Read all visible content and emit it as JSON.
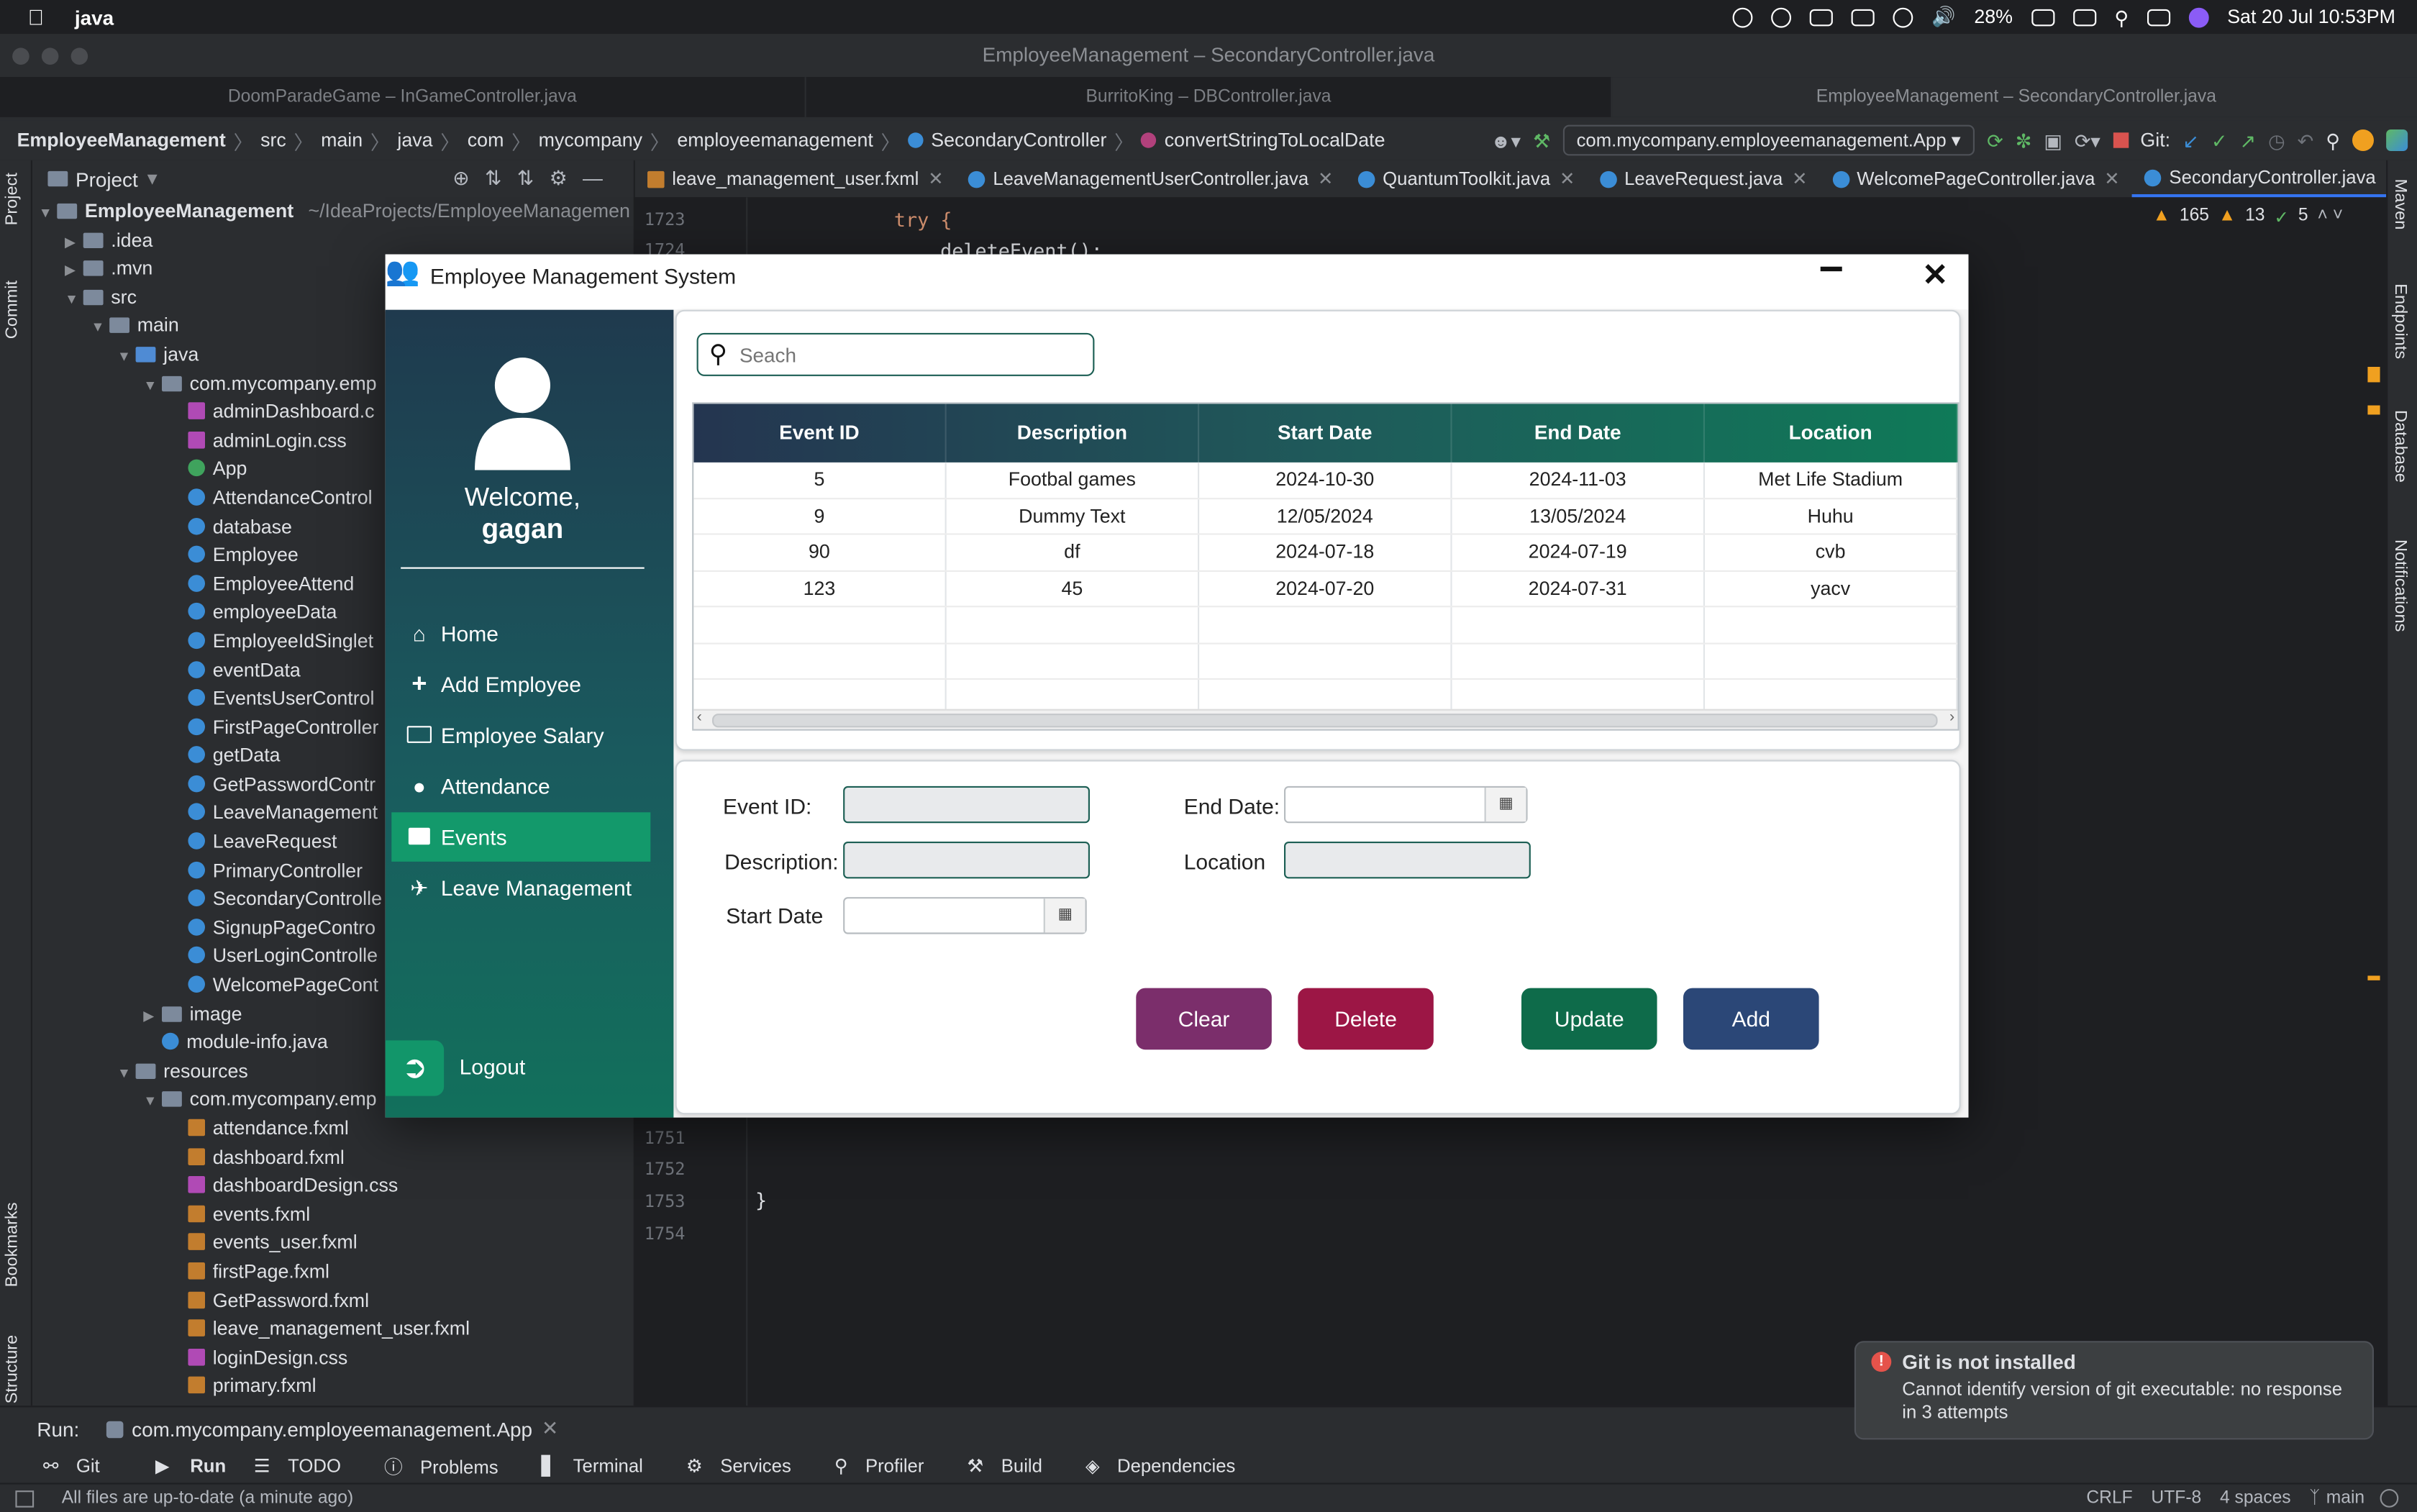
{
  "menubar": {
    "app_name": "java",
    "battery": "28%",
    "datetime": "Sat 20 Jul  10:53PM"
  },
  "window": {
    "title": "EmployeeManagement – SecondaryController.java",
    "project_tabs": [
      "DoomParadeGame – InGameController.java",
      "BurritoKing – DBController.java",
      "EmployeeManagement – SecondaryController.java"
    ]
  },
  "navbar": {
    "crumbs": [
      "EmployeeManagement",
      "src",
      "main",
      "java",
      "com",
      "mycompany",
      "employeemanagement"
    ],
    "class_crumb": "SecondaryController",
    "method_crumb": "convertStringToLocalDate",
    "run_config": "com.mycompany.employeemanagement.App",
    "git_label": "Git:"
  },
  "left_strip": {
    "project": "Project",
    "commit": "Commit",
    "bookmarks": "Bookmarks",
    "structure": "Structure"
  },
  "right_strip": {
    "maven": "Maven",
    "endpoints": "Endpoints",
    "database": "Database",
    "notifications": "Notifications"
  },
  "project_panel": {
    "title": "Project",
    "root": "EmployeeManagement",
    "root_path": "~/IdeaProjects/EmployeeManagemen",
    "tree": [
      {
        "label": ".idea",
        "depth": 1,
        "kind": "folder",
        "arrow": "▶"
      },
      {
        "label": ".mvn",
        "depth": 1,
        "kind": "folder",
        "arrow": "▶"
      },
      {
        "label": "src",
        "depth": 1,
        "kind": "folder",
        "arrow": "▼"
      },
      {
        "label": "main",
        "depth": 2,
        "kind": "folder",
        "arrow": "▼"
      },
      {
        "label": "java",
        "depth": 3,
        "kind": "folder-blue",
        "arrow": "▼"
      },
      {
        "label": "com.mycompany.emp",
        "depth": 4,
        "kind": "folder",
        "arrow": "▼"
      },
      {
        "label": "adminDashboard.c",
        "depth": 5,
        "kind": "css",
        "arrow": ""
      },
      {
        "label": "adminLogin.css",
        "depth": 5,
        "kind": "css",
        "arrow": ""
      },
      {
        "label": "App",
        "depth": 5,
        "kind": "app",
        "arrow": ""
      },
      {
        "label": "AttendanceControl",
        "depth": 5,
        "kind": "class",
        "arrow": ""
      },
      {
        "label": "database",
        "depth": 5,
        "kind": "class",
        "arrow": ""
      },
      {
        "label": "Employee",
        "depth": 5,
        "kind": "class",
        "arrow": ""
      },
      {
        "label": "EmployeeAttend",
        "depth": 5,
        "kind": "class",
        "arrow": ""
      },
      {
        "label": "employeeData",
        "depth": 5,
        "kind": "class",
        "arrow": ""
      },
      {
        "label": "EmployeeIdSinglet",
        "depth": 5,
        "kind": "class",
        "arrow": ""
      },
      {
        "label": "eventData",
        "depth": 5,
        "kind": "class",
        "arrow": ""
      },
      {
        "label": "EventsUserControl",
        "depth": 5,
        "kind": "class",
        "arrow": ""
      },
      {
        "label": "FirstPageController",
        "depth": 5,
        "kind": "class",
        "arrow": ""
      },
      {
        "label": "getData",
        "depth": 5,
        "kind": "class",
        "arrow": ""
      },
      {
        "label": "GetPasswordContr",
        "depth": 5,
        "kind": "class",
        "arrow": ""
      },
      {
        "label": "LeaveManagement",
        "depth": 5,
        "kind": "class",
        "arrow": ""
      },
      {
        "label": "LeaveRequest",
        "depth": 5,
        "kind": "class",
        "arrow": ""
      },
      {
        "label": "PrimaryController",
        "depth": 5,
        "kind": "class",
        "arrow": ""
      },
      {
        "label": "SecondaryControlle",
        "depth": 5,
        "kind": "class",
        "arrow": ""
      },
      {
        "label": "SignupPageContro",
        "depth": 5,
        "kind": "class",
        "arrow": ""
      },
      {
        "label": "UserLoginControlle",
        "depth": 5,
        "kind": "class",
        "arrow": ""
      },
      {
        "label": "WelcomePageCont",
        "depth": 5,
        "kind": "class",
        "arrow": ""
      },
      {
        "label": "image",
        "depth": 4,
        "kind": "folder",
        "arrow": "▶"
      },
      {
        "label": "module-info.java",
        "depth": 4,
        "kind": "class",
        "arrow": ""
      },
      {
        "label": "resources",
        "depth": 3,
        "kind": "folder",
        "arrow": "▼"
      },
      {
        "label": "com.mycompany.emp",
        "depth": 4,
        "kind": "folder",
        "arrow": "▼"
      },
      {
        "label": "attendance.fxml",
        "depth": 5,
        "kind": "fx",
        "arrow": ""
      },
      {
        "label": "dashboard.fxml",
        "depth": 5,
        "kind": "fx",
        "arrow": ""
      },
      {
        "label": "dashboardDesign.css",
        "depth": 5,
        "kind": "css",
        "arrow": ""
      },
      {
        "label": "events.fxml",
        "depth": 5,
        "kind": "fx",
        "arrow": ""
      },
      {
        "label": "events_user.fxml",
        "depth": 5,
        "kind": "fx",
        "arrow": ""
      },
      {
        "label": "firstPage.fxml",
        "depth": 5,
        "kind": "fx",
        "arrow": ""
      },
      {
        "label": "GetPassword.fxml",
        "depth": 5,
        "kind": "fx",
        "arrow": ""
      },
      {
        "label": "leave_management_user.fxml",
        "depth": 5,
        "kind": "fx",
        "arrow": ""
      },
      {
        "label": "loginDesign.css",
        "depth": 5,
        "kind": "css",
        "arrow": ""
      },
      {
        "label": "primary.fxml",
        "depth": 5,
        "kind": "fx",
        "arrow": ""
      }
    ]
  },
  "editor_tabs": [
    {
      "label": "leave_management_user.fxml",
      "active": false
    },
    {
      "label": "LeaveManagementUserController.java",
      "active": false
    },
    {
      "label": "QuantumToolkit.java",
      "active": false
    },
    {
      "label": "LeaveRequest.java",
      "active": false
    },
    {
      "label": "WelcomePageController.java",
      "active": false
    },
    {
      "label": "SecondaryController.java",
      "active": true
    }
  ],
  "inspections": {
    "warnings": "165",
    "weak": "13",
    "ok": "5"
  },
  "editor": {
    "lines_top": [
      {
        "num": "1723",
        "code": "try {"
      },
      {
        "num": "1724",
        "code": "deleteEvent();"
      }
    ],
    "lines_bottom": [
      {
        "num": "1751",
        "code": ""
      },
      {
        "num": "1752",
        "code": ""
      },
      {
        "num": "1753",
        "code": "}"
      },
      {
        "num": "1754",
        "code": ""
      }
    ]
  },
  "run_bar": {
    "label": "Run:",
    "config": "com.mycompany.employeemanagement.App"
  },
  "bottom_tabs": [
    "Git",
    "Run",
    "TODO",
    "Problems",
    "Terminal",
    "Services",
    "Profiler",
    "Build",
    "Dependencies"
  ],
  "status_bar": {
    "message": "All files are up-to-date (a minute ago)",
    "line_sep": "CRLF",
    "encoding": "UTF-8",
    "indent": "4 spaces",
    "branch": "main"
  },
  "notification": {
    "title": "Git is not installed",
    "body": "Cannot identify version of git executable: no response in 3 attempts"
  },
  "app": {
    "title": "Employee Management System",
    "welcome": "Welcome,",
    "username": "gagan",
    "nav": [
      {
        "label": "Home",
        "icon": "home-icon",
        "active": false
      },
      {
        "label": "Add Employee",
        "icon": "plus-icon",
        "active": false
      },
      {
        "label": "Employee Salary",
        "icon": "money-icon",
        "active": false
      },
      {
        "label": "Attendance",
        "icon": "user-icon",
        "active": false
      },
      {
        "label": "Events",
        "icon": "archive-icon",
        "active": true
      },
      {
        "label": "Leave Management",
        "icon": "plane-icon",
        "active": false
      }
    ],
    "logout": "Logout",
    "search_placeholder": "Seach",
    "table": {
      "columns": [
        "Event ID",
        "Description",
        "Start Date",
        "End Date",
        "Location"
      ],
      "rows": [
        [
          "5",
          "Footbal games",
          "2024-10-30",
          "2024-11-03",
          "Met Life Stadium"
        ],
        [
          "9",
          "Dummy Text",
          "12/05/2024",
          "13/05/2024",
          "Huhu"
        ],
        [
          "90",
          "df",
          "2024-07-18",
          "2024-07-19",
          "cvb"
        ],
        [
          "123",
          "45",
          "2024-07-20",
          "2024-07-31",
          "yacv"
        ]
      ]
    },
    "form": {
      "event_id_label": "Event ID:",
      "description_label": "Description:",
      "start_date_label": "Start Date",
      "end_date_label": "End Date:",
      "location_label": "Location"
    },
    "buttons": {
      "clear": "Clear",
      "delete": "Delete",
      "update": "Update",
      "add": "Add",
      "clear_color": "#7b2e6b",
      "delete_color": "#9c1645",
      "update_color": "#0e6b4a",
      "add_color": "#2b4777"
    }
  }
}
